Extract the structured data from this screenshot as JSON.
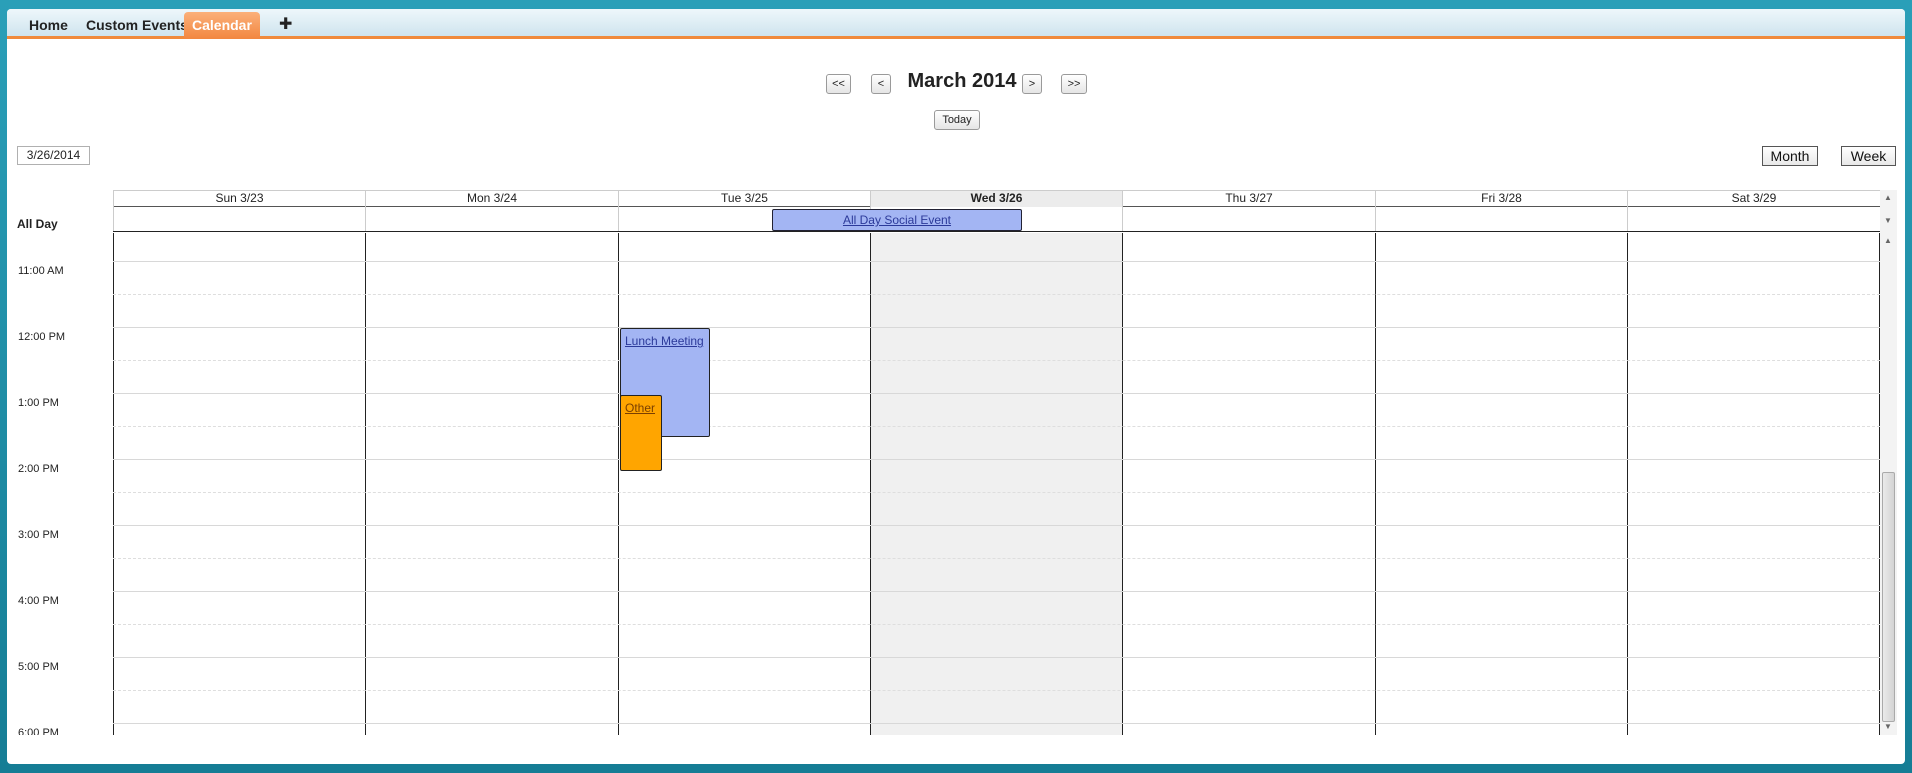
{
  "tabs": [
    {
      "label": "Home",
      "active": false
    },
    {
      "label": "Custom Events",
      "active": false
    },
    {
      "label": "Calendar",
      "active": true
    }
  ],
  "tab_add_symbol": "✚",
  "nav": {
    "first": "<<",
    "prev": "<",
    "title": "March 2014",
    "next": ">",
    "last": ">>",
    "today": "Today"
  },
  "selected_date": "3/26/2014",
  "views": {
    "month": "Month",
    "week": "Week"
  },
  "days": [
    {
      "label": "Sun 3/23",
      "today": false
    },
    {
      "label": "Mon 3/24",
      "today": false
    },
    {
      "label": "Tue 3/25",
      "today": false
    },
    {
      "label": "Wed 3/26",
      "today": true
    },
    {
      "label": "Thu 3/27",
      "today": false
    },
    {
      "label": "Fri 3/28",
      "today": false
    },
    {
      "label": "Sat 3/29",
      "today": false
    }
  ],
  "all_day_label": "All Day",
  "all_day_event": "All Day Social Event",
  "times": [
    "11:00 AM",
    "12:00 PM",
    "1:00 PM",
    "2:00 PM",
    "3:00 PM",
    "4:00 PM",
    "5:00 PM",
    "6:00 PM"
  ],
  "events": [
    {
      "title": "Lunch Meeting",
      "color": "#a3b5f3"
    },
    {
      "title": "Other",
      "color": "#ffa500"
    }
  ],
  "colors": {
    "accent": "#f08a3c",
    "event_blue": "#a3b5f3",
    "event_orange": "#ffa500"
  }
}
